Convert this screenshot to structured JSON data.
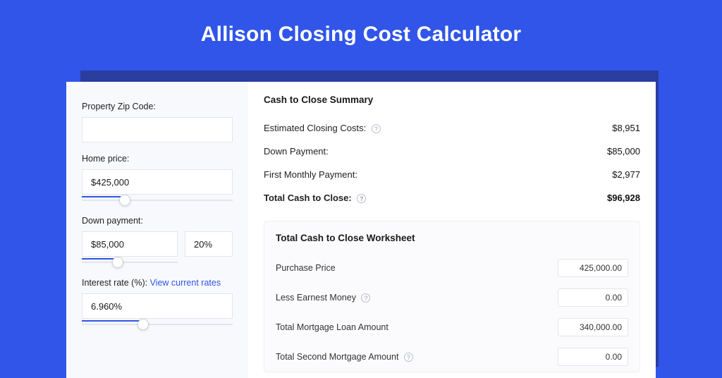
{
  "hero": {
    "title": "Allison Closing Cost Calculator"
  },
  "left": {
    "zip_label": "Property Zip Code:",
    "zip_value": "",
    "home_price_label": "Home price:",
    "home_price_value": "$425,000",
    "down_payment_label": "Down payment:",
    "down_payment_value": "$85,000",
    "down_payment_pct": "20%",
    "interest_label_prefix": "Interest rate (%): ",
    "interest_link": "View current rates",
    "interest_value": "6.960%"
  },
  "summary": {
    "title": "Cash to Close Summary",
    "rows": [
      {
        "label": "Estimated Closing Costs:",
        "value": "$8,951",
        "help": true
      },
      {
        "label": "Down Payment:",
        "value": "$85,000",
        "help": false
      },
      {
        "label": "First Monthly Payment:",
        "value": "$2,977",
        "help": false
      }
    ],
    "total": {
      "label": "Total Cash to Close:",
      "value": "$96,928",
      "help": true
    }
  },
  "worksheet": {
    "title": "Total Cash to Close Worksheet",
    "rows": [
      {
        "label": "Purchase Price",
        "value": "425,000.00",
        "help": false
      },
      {
        "label": "Less Earnest Money",
        "value": "0.00",
        "help": true
      },
      {
        "label": "Total Mortgage Loan Amount",
        "value": "340,000.00",
        "help": false
      },
      {
        "label": "Total Second Mortgage Amount",
        "value": "0.00",
        "help": true
      }
    ]
  },
  "slider": {
    "home_price_fill_pct": 27,
    "down_payment_fill_pct": 36,
    "interest_fill_pct": 40
  }
}
